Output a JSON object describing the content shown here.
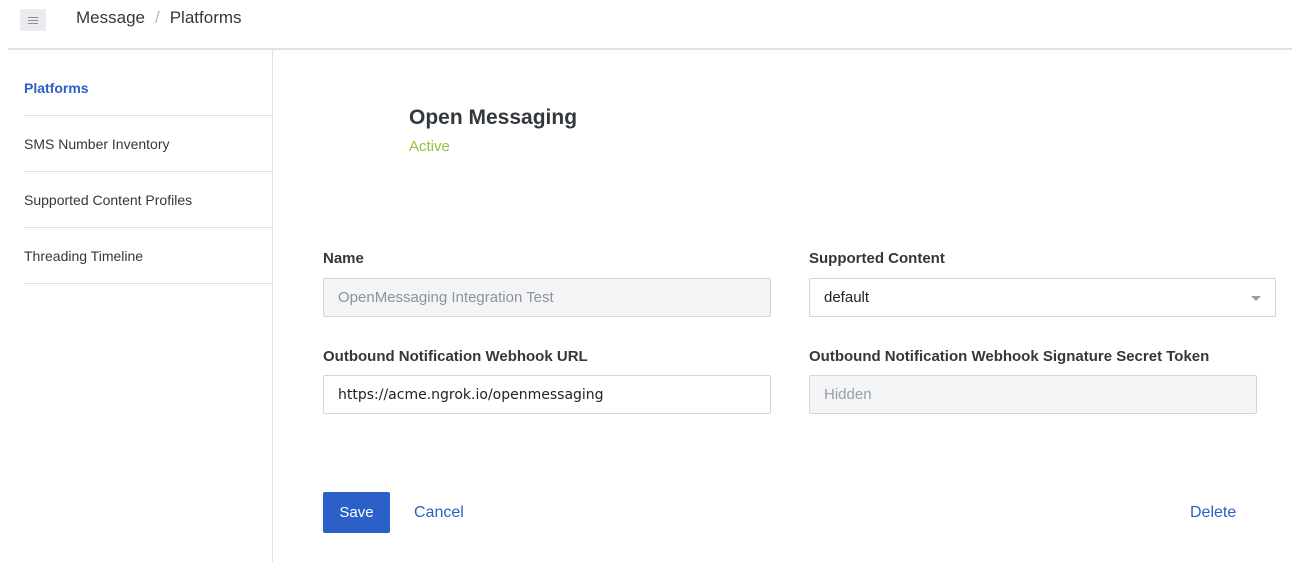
{
  "breadcrumb": {
    "root": "Message",
    "separator": "/",
    "current": "Platforms"
  },
  "sidebar": {
    "items": [
      {
        "label": "Platforms",
        "active": true
      },
      {
        "label": "SMS Number Inventory",
        "active": false
      },
      {
        "label": "Supported Content Profiles",
        "active": false
      },
      {
        "label": "Threading Timeline",
        "active": false
      }
    ]
  },
  "platform": {
    "title": "Open Messaging",
    "status": "Active",
    "status_color": "#8cc63f"
  },
  "form": {
    "name": {
      "label": "Name",
      "value": "OpenMessaging Integration Test"
    },
    "supported_content": {
      "label": "Supported Content",
      "selected": "default"
    },
    "webhook_url": {
      "label": "Outbound Notification Webhook URL",
      "value": "https://acme.ngrok.io/openmessaging"
    },
    "secret_token": {
      "label": "Outbound Notification Webhook Signature Secret Token",
      "value": "Hidden"
    }
  },
  "actions": {
    "save": "Save",
    "cancel": "Cancel",
    "delete": "Delete"
  },
  "colors": {
    "accent": "#2a60c8",
    "active": "#8cc63f",
    "border": "#d2d6db"
  }
}
